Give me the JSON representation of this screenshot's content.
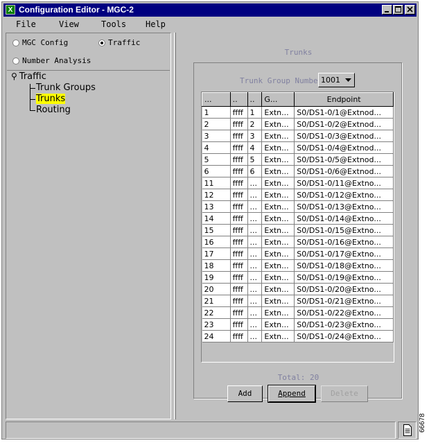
{
  "window": {
    "app_icon_letter": "X",
    "title": "Configuration Editor - MGC-2"
  },
  "menu": [
    "File",
    "View",
    "Tools",
    "Help"
  ],
  "mode_options": [
    {
      "label": "MGC Config",
      "selected": false
    },
    {
      "label": "Traffic",
      "selected": true
    },
    {
      "label": "Number Analysis",
      "selected": false
    }
  ],
  "tree": {
    "root": "Traffic",
    "children": [
      {
        "label": "Trunk Groups",
        "selected": false
      },
      {
        "label": "Trunks",
        "selected": true
      },
      {
        "label": "Routing",
        "selected": false
      }
    ]
  },
  "trunks_panel": {
    "title": "Trunks",
    "group_label": "Trunk Group Number",
    "group_value": "1001",
    "columns": [
      "...",
      "..",
      "..",
      "G...",
      "Endpoint"
    ],
    "rows": [
      [
        "1",
        "ffff",
        "1",
        "Extn...",
        "S0/DS1-0/1@Extnod..."
      ],
      [
        "2",
        "ffff",
        "2",
        "Extn...",
        "S0/DS1-0/2@Extnod..."
      ],
      [
        "3",
        "ffff",
        "3",
        "Extn...",
        "S0/DS1-0/3@Extnod..."
      ],
      [
        "4",
        "ffff",
        "4",
        "Extn...",
        "S0/DS1-0/4@Extnod..."
      ],
      [
        "5",
        "ffff",
        "5",
        "Extn...",
        "S0/DS1-0/5@Extnod..."
      ],
      [
        "6",
        "ffff",
        "6",
        "Extn...",
        "S0/DS1-0/6@Extnod..."
      ],
      [
        "11",
        "ffff",
        "...",
        "Extn...",
        "S0/DS1-0/11@Extno..."
      ],
      [
        "12",
        "ffff",
        "...",
        "Extn...",
        "S0/DS1-0/12@Extno..."
      ],
      [
        "13",
        "ffff",
        "...",
        "Extn...",
        "S0/DS1-0/13@Extno..."
      ],
      [
        "14",
        "ffff",
        "...",
        "Extn...",
        "S0/DS1-0/14@Extno..."
      ],
      [
        "15",
        "ffff",
        "...",
        "Extn...",
        "S0/DS1-0/15@Extno..."
      ],
      [
        "16",
        "ffff",
        "...",
        "Extn...",
        "S0/DS1-0/16@Extno..."
      ],
      [
        "17",
        "ffff",
        "...",
        "Extn...",
        "S0/DS1-0/17@Extno..."
      ],
      [
        "18",
        "ffff",
        "...",
        "Extn...",
        "S0/DS1-0/18@Extno..."
      ],
      [
        "19",
        "ffff",
        "...",
        "Extn...",
        "S0/DS1-0/19@Extno..."
      ],
      [
        "20",
        "ffff",
        "...",
        "Extn...",
        "S0/DS1-0/20@Extno..."
      ],
      [
        "21",
        "ffff",
        "...",
        "Extn...",
        "S0/DS1-0/21@Extno..."
      ],
      [
        "22",
        "ffff",
        "...",
        "Extn...",
        "S0/DS1-0/22@Extno..."
      ],
      [
        "23",
        "ffff",
        "...",
        "Extn...",
        "S0/DS1-0/23@Extno..."
      ],
      [
        "24",
        "ffff",
        "...",
        "Extn...",
        "S0/DS1-0/24@Extno..."
      ]
    ],
    "total": "Total: 20",
    "buttons": {
      "add": "Add",
      "append": "Append",
      "delete": "Delete"
    }
  },
  "figure_id": "66678",
  "colors": {
    "title_bar": "#000080",
    "face": "#c0c0c0",
    "disabled_text": "#8080a0",
    "tree_highlight": "#ffff00"
  }
}
